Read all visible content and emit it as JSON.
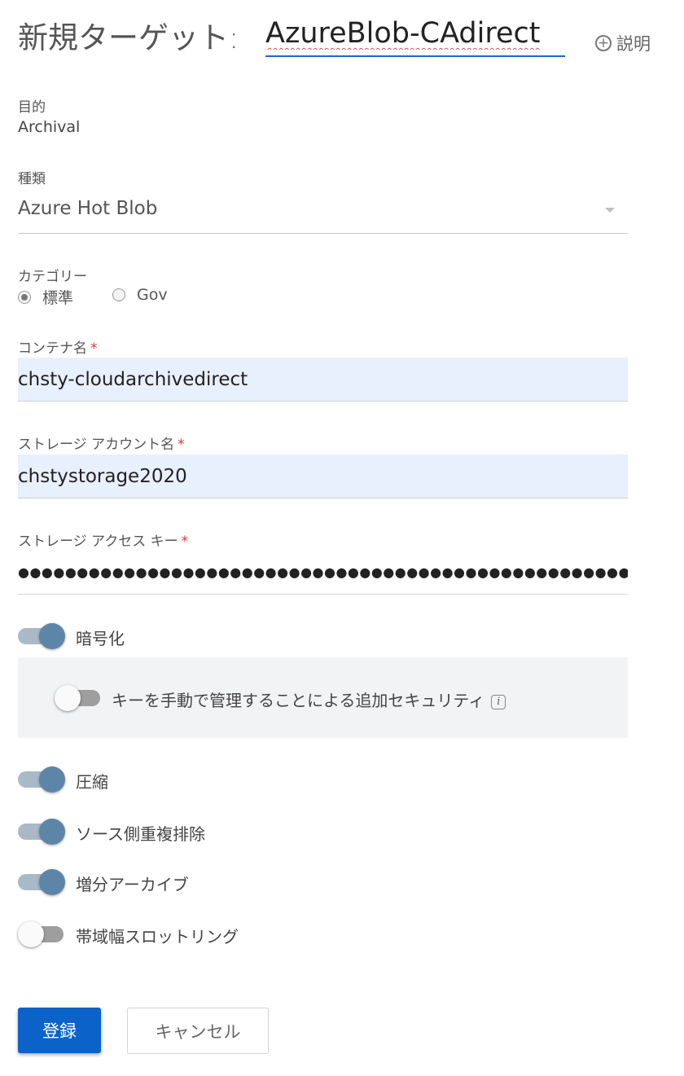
{
  "header": {
    "title_prefix": "新規ターゲット:",
    "target_name": "AzureBlob-CAdirect",
    "help_label": "説明"
  },
  "purpose": {
    "label": "目的",
    "value": "Archival"
  },
  "type": {
    "label": "種類",
    "selected": "Azure Hot Blob"
  },
  "category": {
    "label": "カテゴリー",
    "options": [
      {
        "label": "標準",
        "selected": true
      },
      {
        "label": "Gov",
        "selected": false
      }
    ]
  },
  "container": {
    "label": "コンテナ名",
    "required_mark": "*",
    "value": "chsty-cloudarchivedirect"
  },
  "account": {
    "label": "ストレージ アカウント名",
    "required_mark": "*",
    "value": "chstystorage2020"
  },
  "access_key": {
    "label": "ストレージ アクセス キー",
    "required_mark": "*",
    "masked_value": "●●●●●●●●●●●●●●●●●●●●●●●●●●●●●●●●●●●●●●●●●●●●●●●●●●●●●●●●●●●●●●●●●●●●●●●●●●●●●●●●●●●●●●●●"
  },
  "toggles": {
    "encryption": {
      "label": "暗号化",
      "on": true
    },
    "manual_key": {
      "label": "キーを手動で管理することによる追加セキュリティ",
      "on": false,
      "info_icon": "info-icon"
    },
    "compression": {
      "label": "圧縮",
      "on": true
    },
    "source_dedup": {
      "label": "ソース側重複排除",
      "on": true
    },
    "incremental": {
      "label": "増分アーカイブ",
      "on": true
    },
    "throttling": {
      "label": "帯域幅スロットリング",
      "on": false
    }
  },
  "actions": {
    "submit": "登録",
    "cancel": "キャンセル"
  },
  "colors": {
    "primary": "#0b63c9",
    "toggle_on": "#5d85a8",
    "required": "#d9372b",
    "autofill": "#e8f0fe"
  }
}
